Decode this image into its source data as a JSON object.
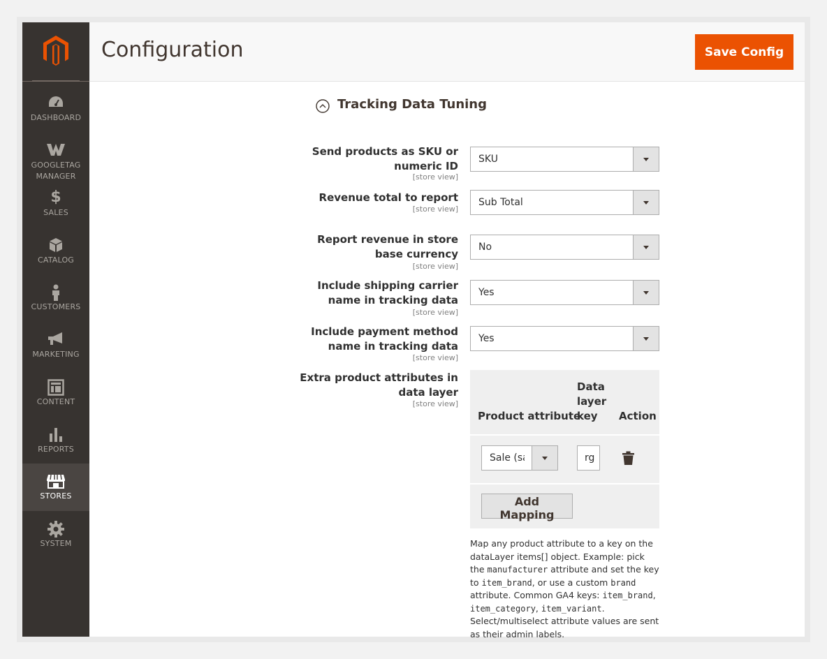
{
  "page": {
    "title": "Configuration",
    "save_label": "Save Config"
  },
  "colors": {
    "brand": "#eb5202",
    "sidebar": "#373330",
    "active_nav": "#4a4542"
  },
  "sidebar": {
    "items": [
      {
        "label": "DASHBOARD",
        "icon": "dashboard-icon"
      },
      {
        "label": "GOOGLETAG MANAGER",
        "icon": "googletag-icon"
      },
      {
        "label": "SALES",
        "icon": "dollar-icon"
      },
      {
        "label": "CATALOG",
        "icon": "cube-icon"
      },
      {
        "label": "CUSTOMERS",
        "icon": "person-icon"
      },
      {
        "label": "MARKETING",
        "icon": "megaphone-icon"
      },
      {
        "label": "CONTENT",
        "icon": "layout-icon"
      },
      {
        "label": "REPORTS",
        "icon": "bar-chart-icon"
      },
      {
        "label": "STORES",
        "icon": "storefront-icon",
        "active": true
      },
      {
        "label": "SYSTEM",
        "icon": "gear-icon"
      }
    ]
  },
  "section": {
    "title": "Tracking Data Tuning"
  },
  "fields": [
    {
      "label_1": "Send products as SKU or",
      "label_2": "numeric ID",
      "scope": "[store view]",
      "value": "SKU"
    },
    {
      "label_1": "Revenue total to report",
      "scope": "[store view]",
      "value": "Sub Total"
    },
    {
      "label_1": "Report revenue in store",
      "label_2": "base currency",
      "scope": "[store view]",
      "value": "No"
    },
    {
      "label_1": "Include shipping carrier",
      "label_2": "name in tracking data",
      "scope": "[store view]",
      "value": "Yes"
    },
    {
      "label_1": "Include payment method",
      "label_2": "name in tracking data",
      "scope": "[store view]",
      "value": "Yes"
    },
    {
      "label_1": "Extra product attributes in",
      "label_2": "data layer",
      "scope": "[store view]"
    }
  ],
  "mapping": {
    "headers": {
      "attribute": "Product attribute",
      "key_1": "Data",
      "key_2": "layer",
      "key_3": "key",
      "action": "Action"
    },
    "rows": [
      {
        "attribute": "Sale (sa",
        "key": "rg"
      }
    ],
    "add_label": "Add Mapping"
  },
  "note": {
    "t1": "Map any product attribute to a key on the dataLayer items[] object. Example: pick the ",
    "c1": "manufacturer",
    "t2": " attribute and set the key to ",
    "c2": "item_brand",
    "t3": ", or use a custom ",
    "c3": "brand",
    "t4": " attribute. Common GA4 keys: ",
    "c4": "item_brand",
    "t5": ", ",
    "c5": "item_category",
    "t6": ", ",
    "c6": "item_variant",
    "t7": ". Select/multiselect attribute values are sent as their admin labels."
  }
}
